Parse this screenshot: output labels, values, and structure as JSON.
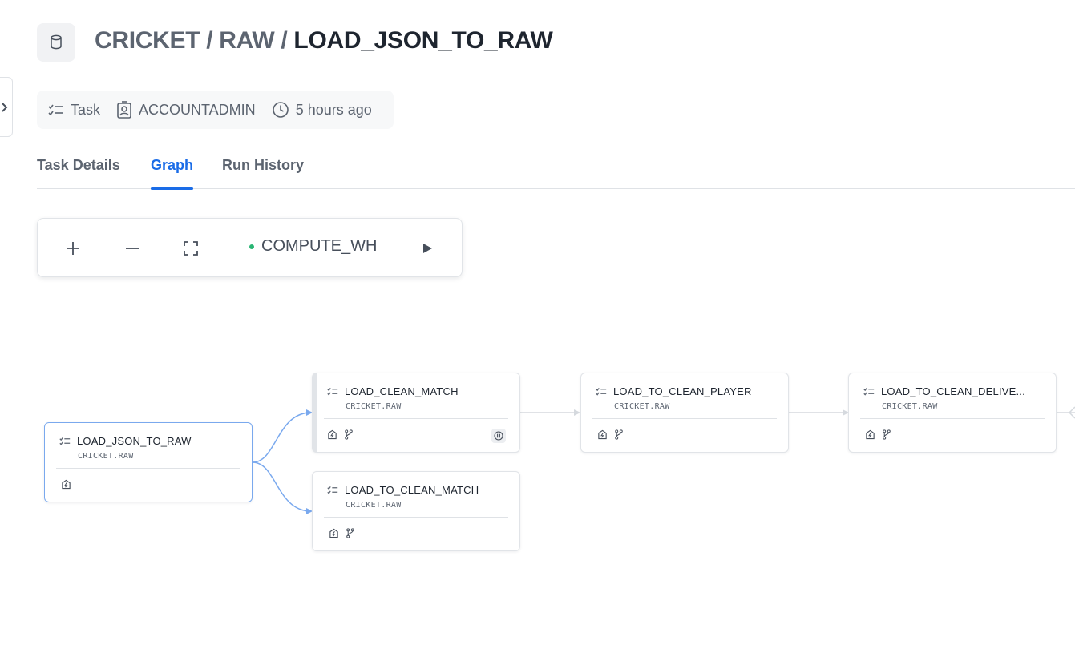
{
  "breadcrumb": {
    "database": "CRICKET",
    "separator": "/",
    "schema": "RAW",
    "object": "LOAD_JSON_TO_RAW"
  },
  "meta": {
    "type": "Task",
    "owner": "ACCOUNTADMIN",
    "modified": "5 hours ago"
  },
  "tabs": [
    {
      "label": "Task Details",
      "active": false
    },
    {
      "label": "Graph",
      "active": true
    },
    {
      "label": "Run History",
      "active": false
    }
  ],
  "toolbar": {
    "warehouse": "COMPUTE_WH",
    "warehouse_status_color": "#29b573",
    "icons": [
      "zoom-in-icon",
      "zoom-out-icon",
      "fit-view-icon",
      "run-icon"
    ]
  },
  "nodes": [
    {
      "name": "LOAD_JSON_TO_RAW",
      "schema": "CRICKET.RAW",
      "selected": true,
      "paused": false
    },
    {
      "name": "LOAD_CLEAN_MATCH",
      "schema": "CRICKET.RAW",
      "selected": false,
      "paused": true
    },
    {
      "name": "LOAD_TO_CLEAN_MATCH",
      "schema": "CRICKET.RAW",
      "selected": false,
      "paused": false
    },
    {
      "name": "LOAD_TO_CLEAN_PLAYER",
      "schema": "CRICKET.RAW",
      "selected": false,
      "paused": false
    },
    {
      "name": "LOAD_TO_CLEAN_DELIVE...",
      "schema": "CRICKET.RAW",
      "selected": false,
      "paused": false
    }
  ],
  "colors": {
    "accent": "#1a6ce7",
    "selected_edge": "#7aa9ee",
    "edge": "#d5d9de"
  }
}
